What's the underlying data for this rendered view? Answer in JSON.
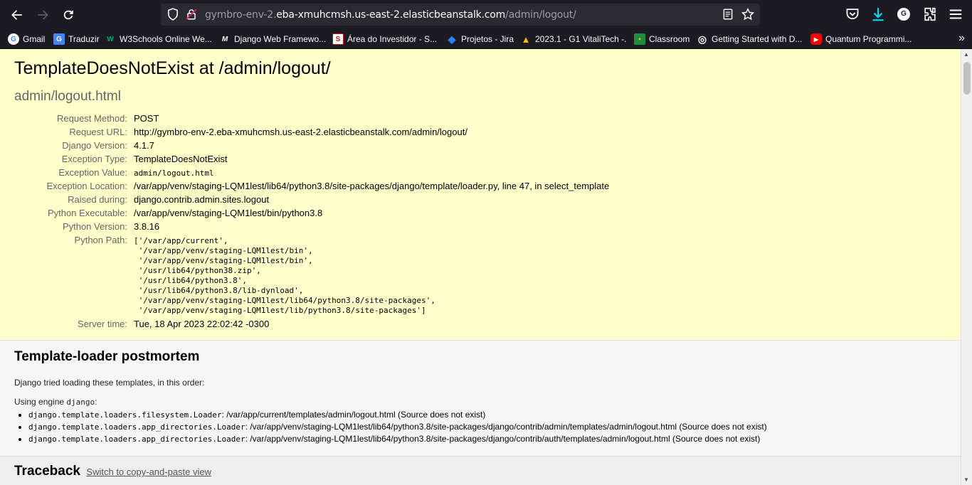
{
  "browser": {
    "url_prefix": "gymbro-env-2.",
    "url_host": "eba-xmuhcmsh.us-east-2.elasticbeanstalk.com",
    "url_path": "/admin/logout/",
    "account_initial": "G",
    "bookmarks": [
      {
        "label": "Gmail",
        "icon": "google-icon",
        "color": "#ffffff"
      },
      {
        "label": "Traduzir",
        "icon": "translate-icon",
        "color": "#4285f4"
      },
      {
        "label": "W3Schools Online We...",
        "icon": "w3schools-icon",
        "color": "#04aa6d"
      },
      {
        "label": "Django Web Framewo...",
        "icon": "mdn-icon",
        "color": "#ffffff"
      },
      {
        "label": "Área do Investidor - S...",
        "icon": "investor-icon",
        "color": "#c4161c"
      },
      {
        "label": "Projetos - Jira",
        "icon": "jira-icon",
        "color": "#2684ff"
      },
      {
        "label": "2023.1 - G1 VitaliTech -...",
        "icon": "drive-icon",
        "color": "#fbbc04"
      },
      {
        "label": "Classroom",
        "icon": "classroom-icon",
        "color": "#1e8e3e"
      },
      {
        "label": "Getting Started with D...",
        "icon": "globe-icon",
        "color": "#fbfbfe"
      },
      {
        "label": "Quantum Programmi...",
        "icon": "youtube-icon",
        "color": "#ff0000"
      }
    ]
  },
  "summary": {
    "title": "TemplateDoesNotExist at /admin/logout/",
    "subtitle": "admin/logout.html",
    "rows": [
      {
        "label": "Request Method:",
        "value": "POST"
      },
      {
        "label": "Request URL:",
        "value": "http://gymbro-env-2.eba-xmuhcmsh.us-east-2.elasticbeanstalk.com/admin/logout/"
      },
      {
        "label": "Django Version:",
        "value": "4.1.7"
      },
      {
        "label": "Exception Type:",
        "value": "TemplateDoesNotExist"
      },
      {
        "label": "Exception Value:",
        "value": "admin/logout.html"
      },
      {
        "label": "Exception Location:",
        "value": "/var/app/venv/staging-LQM1lest/lib64/python3.8/site-packages/django/template/loader.py, line 47, in select_template"
      },
      {
        "label": "Raised during:",
        "value": "django.contrib.admin.sites.logout"
      },
      {
        "label": "Python Executable:",
        "value": "/var/app/venv/staging-LQM1lest/bin/python3.8"
      },
      {
        "label": "Python Version:",
        "value": "3.8.16"
      },
      {
        "label": "Python Path:",
        "value": "['/var/app/current',\n '/var/app/venv/staging-LQM1lest/bin',\n '/var/app/venv/staging-LQM1lest/bin',\n '/usr/lib64/python38.zip',\n '/usr/lib64/python3.8',\n '/usr/lib64/python3.8/lib-dynload',\n '/var/app/venv/staging-LQM1lest/lib64/python3.8/site-packages',\n '/var/app/venv/staging-LQM1lest/lib/python3.8/site-packages']"
      },
      {
        "label": "Server time:",
        "value": "Tue, 18 Apr 2023 22:02:42 -0300"
      }
    ]
  },
  "postmortem": {
    "title": "Template-loader postmortem",
    "intro": "Django tried loading these templates, in this order:",
    "engine_prefix": "Using engine ",
    "engine_name": "django",
    "engine_suffix": ":",
    "items": [
      {
        "loader": "django.template.loaders.filesystem.Loader",
        "detail": ": /var/app/current/templates/admin/logout.html (Source does not exist)"
      },
      {
        "loader": "django.template.loaders.app_directories.Loader",
        "detail": ": /var/app/venv/staging-LQM1lest/lib64/python3.8/site-packages/django/contrib/admin/templates/admin/logout.html (Source does not exist)"
      },
      {
        "loader": "django.template.loaders.app_directories.Loader",
        "detail": ": /var/app/venv/staging-LQM1lest/lib64/python3.8/site-packages/django/contrib/auth/templates/admin/logout.html (Source does not exist)"
      }
    ]
  },
  "traceback": {
    "title": "Traceback",
    "switch_link": "Switch to copy-and-paste view"
  }
}
